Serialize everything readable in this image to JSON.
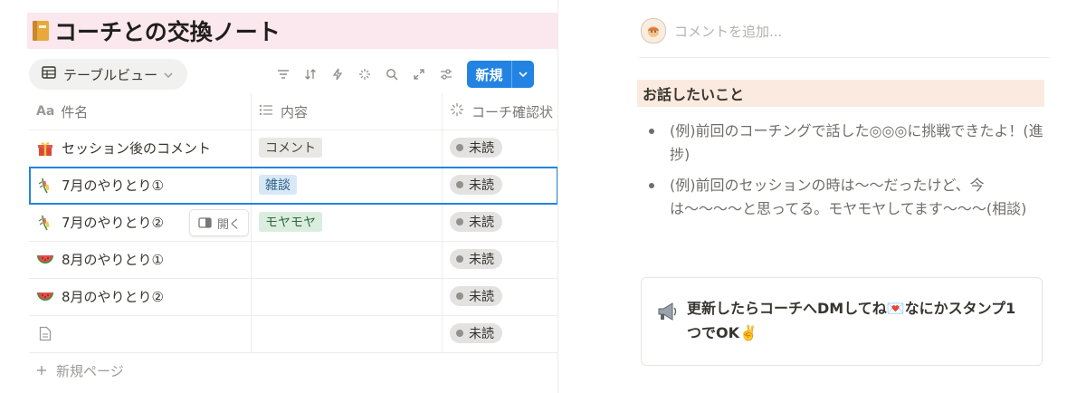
{
  "page": {
    "title": "コーチとの交換ノート",
    "title_icon": "notebook-icon"
  },
  "toolbar": {
    "view_label": "テーブルビュー",
    "new_label": "新規"
  },
  "table": {
    "columns": [
      {
        "prefix": "Aa",
        "label": "件名",
        "icon": "text-property-icon"
      },
      {
        "label": "内容",
        "icon": "list-property-icon"
      },
      {
        "label": "コーチ確認状",
        "icon": "status-property-icon"
      }
    ],
    "rows": [
      {
        "emoji": "gift-icon",
        "name": "セッション後のコメント",
        "tag": "コメント",
        "tag_color": "#e9e8e5",
        "tag_text": "#4a4843",
        "status": "未読"
      },
      {
        "emoji": "tanabata-icon",
        "name": "7月のやりとり①",
        "tag": "雑談",
        "tag_color": "#d8e8f7",
        "tag_text": "#2a5b84",
        "status": "未読"
      },
      {
        "emoji": "tanabata-icon",
        "name": "7月のやりとり②",
        "tag": "モヤモヤ",
        "tag_color": "#dbeddf",
        "tag_text": "#2f6a43",
        "status": "未読"
      },
      {
        "emoji": "watermelon-icon",
        "name": "8月のやりとり①",
        "tag": "",
        "status": "未読"
      },
      {
        "emoji": "watermelon-icon",
        "name": "8月のやりとり②",
        "tag": "",
        "status": "未読"
      },
      {
        "emoji": "page-icon",
        "name": "",
        "tag": "",
        "status": "未読"
      }
    ],
    "open_label": "開く",
    "new_page_label": "新規ページ"
  },
  "panel": {
    "comment_placeholder": "コメントを追加...",
    "heading": "お話したいこと",
    "bullets": [
      "(例)前回のコーチングで話した◎◎◎に挑戦できたよ！(進捗)",
      "(例)前回のセッションの時は〜〜だったけど、今は〜〜〜〜と思ってる。モヤモヤしてます〜〜〜(相談)"
    ],
    "callout_text": "更新したらコーチへDMしてね💌なにかスタンプ1つでOK✌️",
    "callout_icon": "megaphone-icon"
  },
  "colors": {
    "accent": "#2383e2",
    "title_highlight": "#fbe7ee",
    "heading_highlight": "#fbeadf"
  }
}
